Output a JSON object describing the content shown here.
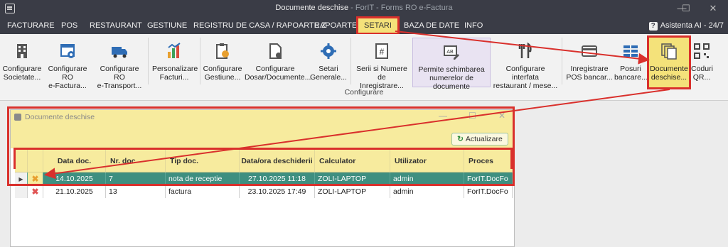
{
  "window": {
    "title": "Documente deschise",
    "subtitle": " - ForIT - Forms RO e-Factura",
    "minimize": "—",
    "maximize": "☐",
    "close": "✕"
  },
  "menu": {
    "items": [
      "FACTURARE",
      "POS",
      "RESTAURANT",
      "GESTIUNE",
      "REGISTRU DE CASA / RAPOARTE Z",
      "RAPOARTE",
      "SETARI",
      "BAZA DE DATE",
      "INFO"
    ],
    "active": "SETARI",
    "help": "Asistenta AI - 24/7"
  },
  "ribbon": {
    "group_label": "Configurare",
    "buttons": [
      {
        "l1": "Configurare",
        "l2": "Societate..."
      },
      {
        "l1": "Configurare RO",
        "l2": "e-Factura..."
      },
      {
        "l1": "Configurare RO",
        "l2": "e-Transport..."
      },
      {
        "l1": "Personalizare",
        "l2": "Facturi..."
      },
      {
        "l1": "Configurare",
        "l2": "Gestiune..."
      },
      {
        "l1": "Configurare",
        "l2": "Dosar/Documente..."
      },
      {
        "l1": "Setari",
        "l2": "Generale..."
      },
      {
        "l1": "Serii si Numere de",
        "l2": "Inregistrare..."
      },
      {
        "l1": "Permite schimbarea",
        "l2": "numerelor de documente"
      },
      {
        "l1": "Configurare interfata",
        "l2": "restaurant / mese..."
      },
      {
        "l1": "Inregistrare",
        "l2": "POS bancar..."
      },
      {
        "l1": "Posuri",
        "l2": "bancare..."
      },
      {
        "l1": "Documente",
        "l2": "deschise..."
      },
      {
        "l1": "Coduri",
        "l2": "QR..."
      }
    ]
  },
  "child_window": {
    "title": "Documente deschise",
    "refresh_label": "Actualizare"
  },
  "grid": {
    "columns": [
      "",
      "",
      "Data doc.",
      "Nr. doc",
      "Tip doc.",
      "Data/ora deschiderii",
      "Calculator",
      "Utilizator",
      "Proces"
    ],
    "rows": [
      {
        "data_doc": "14.10.2025",
        "nr_doc": "7",
        "tip_doc": "nota de receptie",
        "data_ora": "27.10.2025 11:18",
        "calculator": "ZOLI-LAPTOP",
        "utilizator": "admin",
        "proces": "ForIT.DocFo"
      },
      {
        "data_doc": "21.10.2025",
        "nr_doc": "13",
        "tip_doc": "factura",
        "data_ora": "23.10.2025 17:49",
        "calculator": "ZOLI-LAPTOP",
        "utilizator": "admin",
        "proces": "ForIT.DocFo"
      }
    ]
  },
  "colors": {
    "titlebar": "#3a3c46",
    "highlight_yellow": "#f4e27a",
    "annotation_red": "#d9302c",
    "selected_row": "#3e8f80"
  }
}
